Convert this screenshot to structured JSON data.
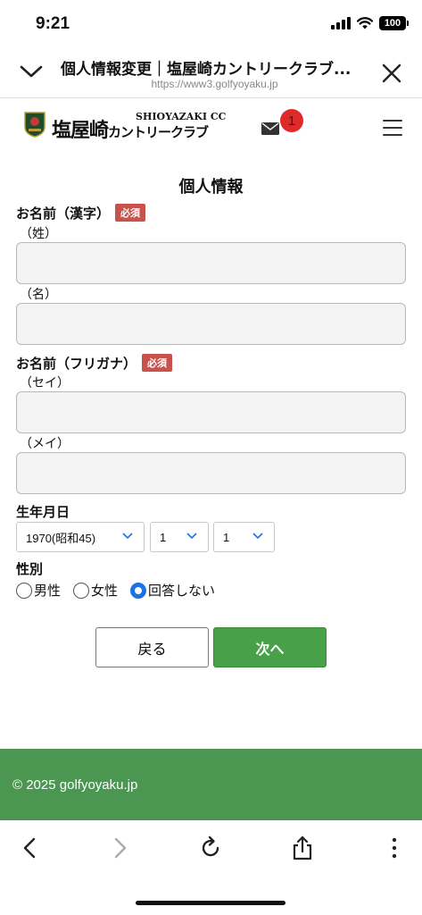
{
  "status_bar": {
    "time": "9:21",
    "battery": "100"
  },
  "browser": {
    "title": "個人情報変更｜塩屋崎カントリークラブ...",
    "url": "https://www3.golfyoyaku.jp"
  },
  "site": {
    "logo_jp_main": "塩屋崎",
    "logo_jp_sub": "カントリークラブ",
    "logo_en": "SHIOYAZAKI CC",
    "mail_count": "1"
  },
  "form": {
    "title": "個人情報",
    "name_kanji": {
      "label": "お名前（漢字）",
      "required": "必須",
      "last_label": "（姓）",
      "first_label": "（名）",
      "last_value": "",
      "first_value": ""
    },
    "name_kana": {
      "label": "お名前（フリガナ）",
      "required": "必須",
      "last_label": "（セイ）",
      "first_label": "（メイ）",
      "last_value": "",
      "first_value": ""
    },
    "birthday": {
      "label": "生年月日",
      "year": "1970(昭和45)",
      "month": "1",
      "day": "1"
    },
    "gender": {
      "label": "性別",
      "options": [
        "男性",
        "女性",
        "回答しない"
      ],
      "selected": "回答しない"
    },
    "back_button": "戻る",
    "next_button": "次へ"
  },
  "footer": {
    "copyright": "© 2025 golfyoyaku.jp"
  },
  "colors": {
    "footer_bg": "#4b9651",
    "next_button": "#48a048",
    "required_badge": "#c9524c",
    "mail_badge": "#e02a2a",
    "radio_selected": "#1a73e8"
  },
  "toolbar": {
    "icons": [
      "back-icon",
      "forward-icon",
      "reload-icon",
      "share-icon",
      "more-icon"
    ]
  }
}
